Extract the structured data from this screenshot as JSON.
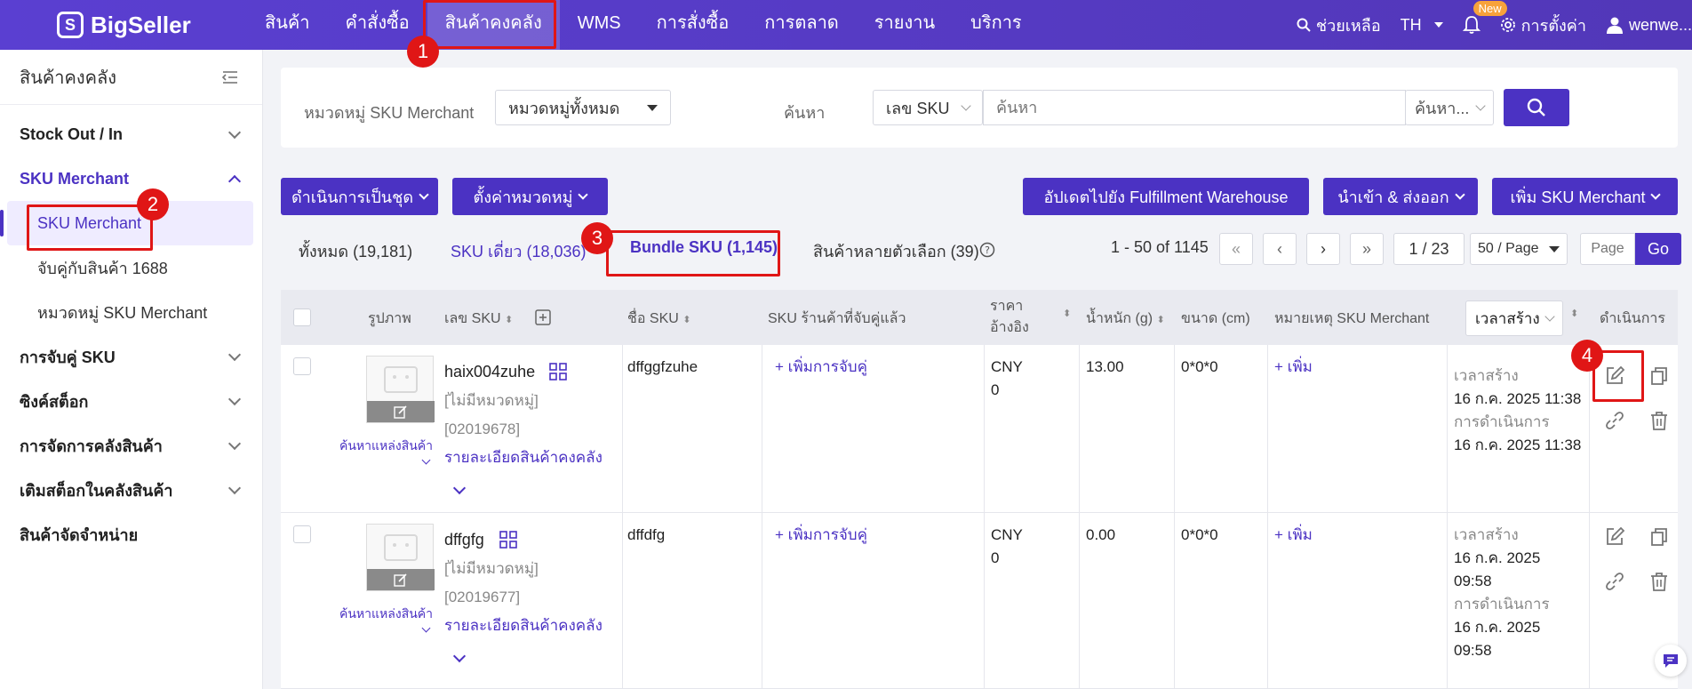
{
  "header": {
    "logo": "BigSeller",
    "nav": [
      "สินค้า",
      "คำสั่งซื้อ",
      "สินค้าคงคลัง",
      "WMS",
      "การสั่งซื้อ",
      "การตลาด",
      "รายงาน",
      "บริการ"
    ],
    "help": "ช่วยเหลือ",
    "lang": "TH",
    "new_badge": "New",
    "settings": "การตั้งค่า",
    "user": "wenwe..."
  },
  "callouts": [
    "1",
    "2",
    "3",
    "4"
  ],
  "sidebar": {
    "title": "สินค้าคงคลัง",
    "groups": [
      {
        "label": "Stock Out / In"
      },
      {
        "label": "SKU Merchant",
        "subs": [
          "SKU Merchant",
          "จับคู่กับสินค้า 1688",
          "หมวดหมู่ SKU Merchant"
        ]
      },
      {
        "label": "การจับคู่ SKU"
      },
      {
        "label": "ซิงค์สต็อก"
      },
      {
        "label": "การจัดการคลังสินค้า"
      },
      {
        "label": "เติมสต็อกในคลังสินค้า"
      },
      {
        "label": "สินค้าจัดจำหน่าย"
      }
    ]
  },
  "filter": {
    "category_label": "หมวดหมู่ SKU Merchant",
    "category_value": "หมวดหมู่ทั้งหมด",
    "search_label": "ค้นหา",
    "search_type": "เลข SKU",
    "search_placeholder": "ค้นหา",
    "search_mode": "ค้นหา..."
  },
  "actions": {
    "bulk": "ดำเนินการเป็นชุด",
    "set_category": "ตั้งค่าหมวดหมู่",
    "update_fulfillment": "อัปเดตไปยัง Fulfillment Warehouse",
    "import_export": "นำเข้า & ส่งออก",
    "add_sku": "เพิ่ม SKU Merchant"
  },
  "tabs": {
    "all": "ทั้งหมด (19,181)",
    "single": "SKU เดี่ยว (18,036)",
    "bundle": "Bundle SKU (1,145)",
    "variant": "สินค้าหลายตัวเลือก (39)"
  },
  "pager": {
    "range": "1 - 50 of 1145",
    "page": "1 / 23",
    "per_page": "50 / Page",
    "page_placeholder": "Page",
    "go": "Go"
  },
  "table": {
    "headers": {
      "image": "รูปภาพ",
      "sku": "เลข SKU",
      "name": "ชื่อ SKU",
      "shop_sku": "SKU ร้านค้าที่จับคู่แล้ว",
      "price_line1": "ราคา",
      "price_line2": "อ้างอิง",
      "weight": "น้ำหนัก (g)",
      "size": "ขนาด (cm)",
      "note": "หมายเหตุ SKU Merchant",
      "time_select": "เวลาสร้าง",
      "action": "ดำเนินการ"
    },
    "rows": [
      {
        "sku": "haix004zuhe",
        "category": "[ไม่มีหมวดหมู่]",
        "code": "[02019678]",
        "detail_link": "รายละเอียดสินค้าคงคลัง",
        "find_source": "ค้นหาแหล่งสินค้า",
        "name": "dffggfzuhe",
        "add_match": "+ เพิ่มการจับคู่",
        "currency": "CNY",
        "price": "0",
        "weight": "13.00",
        "size": "0*0*0",
        "add_note": "+ เพิ่ม",
        "created_label": "เวลาสร้าง",
        "created": "16 ก.ค. 2025 11:38",
        "updated_label": "การดำเนินการ",
        "updated": "16 ก.ค. 2025 11:38"
      },
      {
        "sku": "dffgfg",
        "category": "[ไม่มีหมวดหมู่]",
        "code": "[02019677]",
        "detail_link": "รายละเอียดสินค้าคงคลัง",
        "find_source": "ค้นหาแหล่งสินค้า",
        "name": "dffdfg",
        "add_match": "+ เพิ่มการจับคู่",
        "currency": "CNY",
        "price": "0",
        "weight": "0.00",
        "size": "0*0*0",
        "add_note": "+ เพิ่ม",
        "created_label": "เวลาสร้าง",
        "created_l1": "16 ก.ค. 2025",
        "created_l2": "09:58",
        "updated_label": "การดำเนินการ",
        "updated_l1": "16 ก.ค. 2025",
        "updated_l2": "09:58"
      }
    ]
  },
  "colors": {
    "primary": "#4b32c3",
    "highlight": "#e01616",
    "header": "#5a3fd1"
  }
}
